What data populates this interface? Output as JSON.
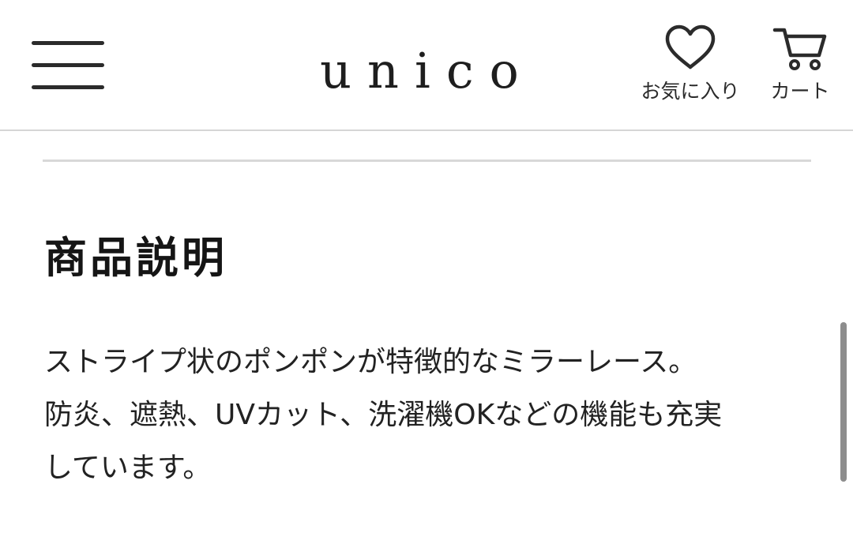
{
  "header": {
    "logo": "unico",
    "favorites_label": "お気に入り",
    "cart_label": "カート"
  },
  "icons": {
    "menu": "hamburger-menu-icon",
    "favorites": "heart-icon",
    "cart": "cart-icon"
  },
  "product": {
    "section_title": "商品説明",
    "description": "ストライプ状のポンポンが特徴的なミラーレース。\n防炎、遮熱、UVカット、洗濯機OKなどの機能も充実\nしています。"
  },
  "colors": {
    "text": "#1a1a1a",
    "divider": "#d8d8d8",
    "scrollbar": "#8d8d8d"
  }
}
